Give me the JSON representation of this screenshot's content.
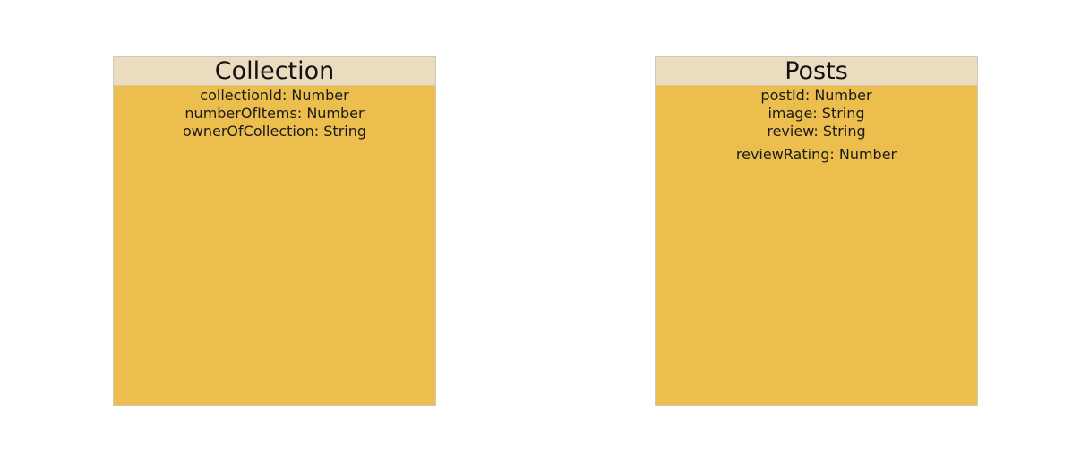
{
  "entities": [
    {
      "name": "Collection",
      "fields": [
        "collectionId: Number",
        "numberOfItems: Number",
        "ownerOfCollection: String"
      ]
    },
    {
      "name": "Posts",
      "fields": [
        "postId: Number",
        "image: String",
        "review: String",
        "reviewRating: Number"
      ]
    }
  ],
  "colors": {
    "header_background": "#ecdcbf",
    "body_background": "#ecbe4e",
    "page_background": "#ffffff"
  }
}
